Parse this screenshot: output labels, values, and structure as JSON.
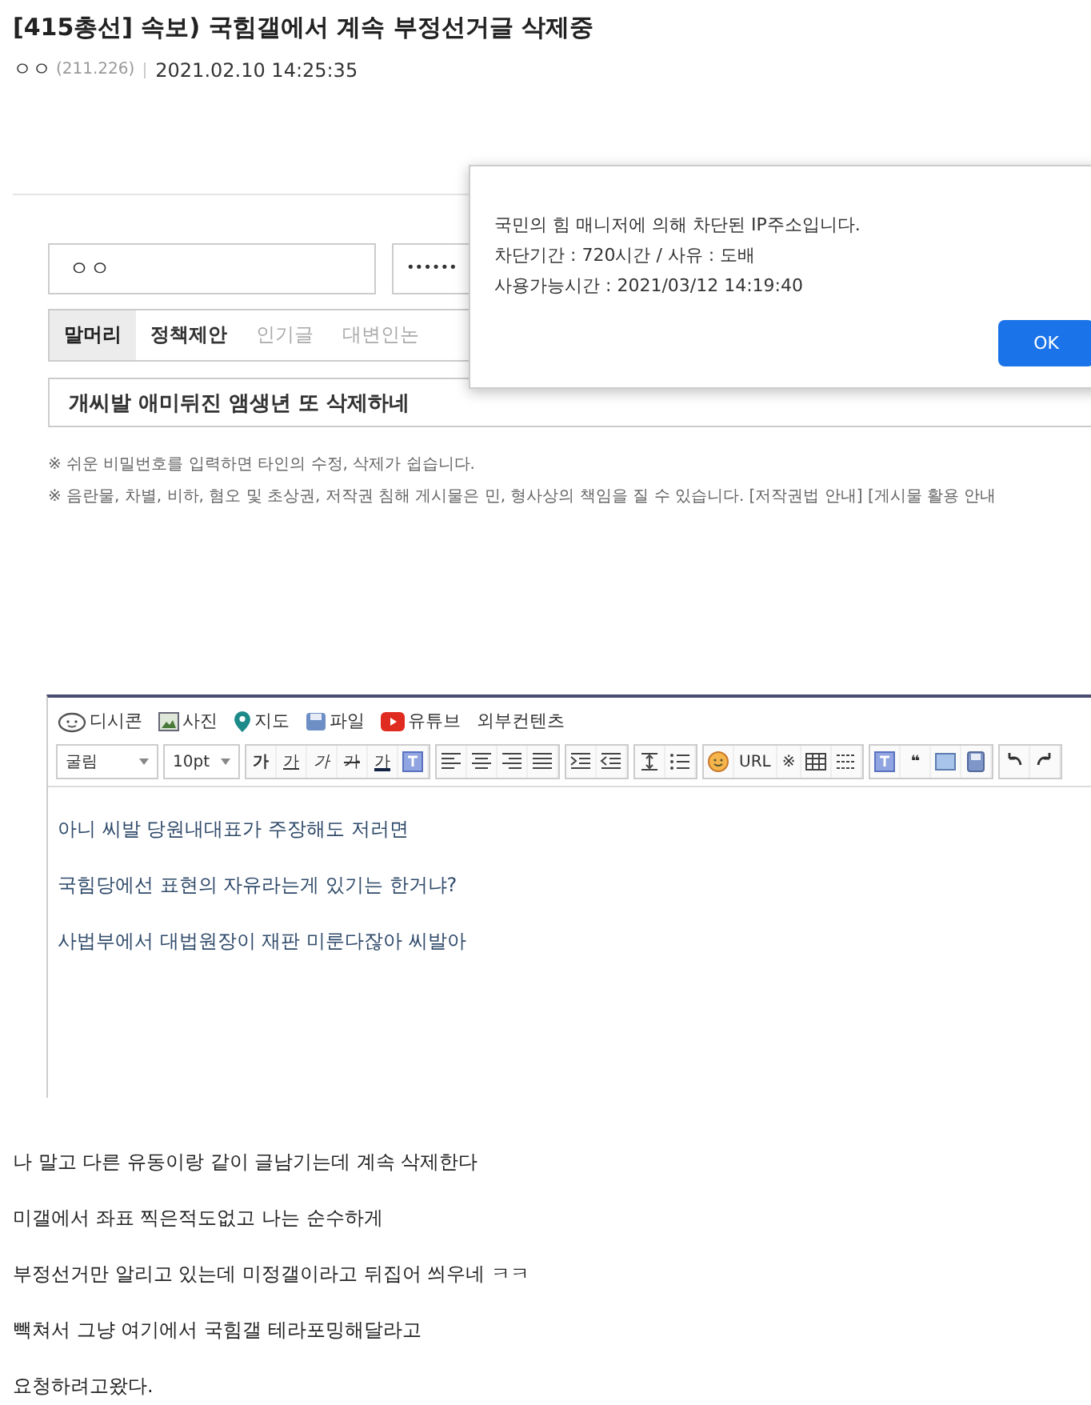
{
  "post": {
    "title": "[415총선] 속보) 국힘갤에서 계속 부정선거글 삭제중",
    "author": "ㅇㅇ",
    "ip": "(211.226)",
    "date": "2021.02.10 14:25:35"
  },
  "form": {
    "name_value": "ㅇㅇ",
    "password_value": "••••••",
    "tabs": [
      {
        "label": "말머리",
        "selected": true,
        "disabled": false
      },
      {
        "label": "정책제안",
        "selected": false,
        "disabled": false
      },
      {
        "label": "인기글",
        "selected": false,
        "disabled": true
      },
      {
        "label": "대변인논",
        "selected": false,
        "disabled": true
      }
    ],
    "subject_value": "개씨발 애미뒤진 앰생년 또 삭제하네",
    "notes": [
      "※ 쉬운 비밀번호를 입력하면 타인의 수정, 삭제가 쉽습니다.",
      "※ 음란물, 차별, 비하, 혐오 및 초상권, 저작권 침해 게시물은 민, 형사상의 책임을 질 수 있습니다. [저작권법 안내] [게시물 활용 안내"
    ]
  },
  "dialog": {
    "lines": [
      "국민의 힘 매니저에 의해 차단된 IP주소입니다.",
      "차단기간 : 720시간 / 사유 : 도배",
      "사용가능시간 : 2021/03/12 14:19:40"
    ],
    "button": "OK"
  },
  "editor": {
    "attach": [
      {
        "kind": "dccon",
        "label": "디시콘"
      },
      {
        "kind": "photo",
        "label": "사진"
      },
      {
        "kind": "map",
        "label": "지도"
      },
      {
        "kind": "file",
        "label": "파일"
      },
      {
        "kind": "youtube",
        "label": "유튜브"
      },
      {
        "kind": "none",
        "label": "외부컨텐츠"
      }
    ],
    "font_face": "굴림",
    "font_size": "10pt",
    "format_labels": [
      "가",
      "가",
      "가",
      "가",
      "가"
    ],
    "insert_labels": [
      "URL",
      "※"
    ],
    "quote_label": "❝",
    "lines": [
      "아니 씨발 당원내대표가 주장해도 저러면",
      "국힘당에선 표현의 자유라는게 있기는 한거냐?",
      "사법부에서 대법원장이 재판 미룬다잖아 씨발아"
    ]
  },
  "body": [
    "나 말고 다른 유동이랑 같이 글남기는데 계속 삭제한다",
    "미갤에서 좌표 찍은적도없고 나는 순수하게",
    "부정선거만 알리고 있는데 미정갤이라고 뒤집어 씌우네 ㅋㅋ",
    "빽쳐서 그냥 여기에서 국힘갤 테라포밍해달라고",
    "요청하려고왔다."
  ]
}
